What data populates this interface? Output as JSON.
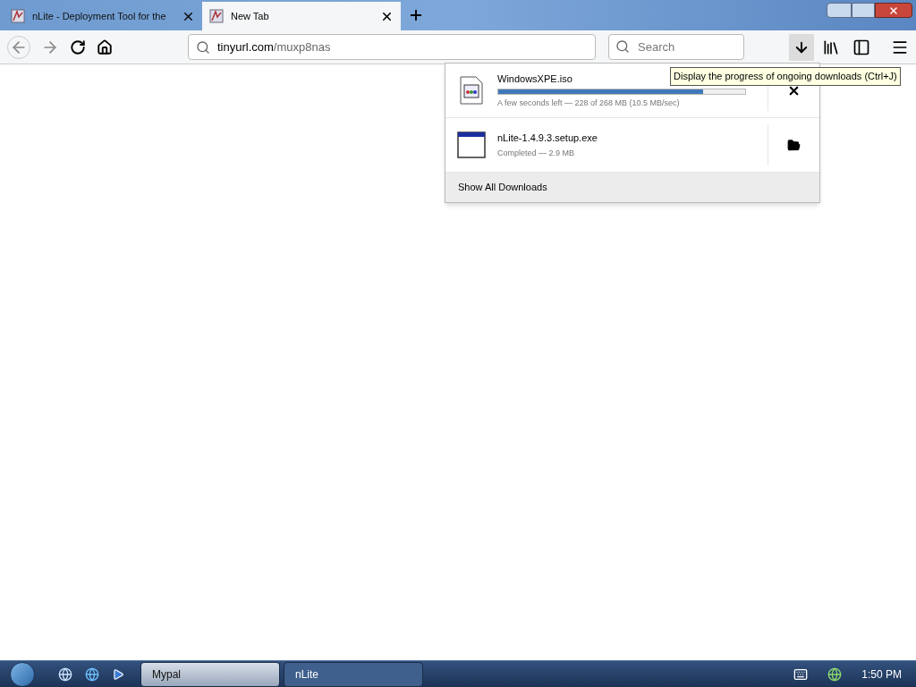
{
  "tabs": [
    {
      "title": "nLite - Deployment Tool for the",
      "selected": false
    },
    {
      "title": "New Tab",
      "selected": true
    }
  ],
  "address": {
    "host": "tinyurl.com",
    "path": "/muxp8nas"
  },
  "search": {
    "placeholder": "Search"
  },
  "toolbar": {
    "downloads_pressed": true
  },
  "downloads": {
    "items": [
      {
        "kind": "in_progress",
        "name": "WindowsXPE.iso",
        "status": "A few seconds left — 228 of 268 MB (10.5 MB/sec)",
        "level": 0.83
      },
      {
        "kind": "completed",
        "name": "nLite-1.4.9.3.setup.exe",
        "status": "Completed — 2.9 MB"
      }
    ],
    "footer": "Show All Downloads"
  },
  "tooltip": "Display the progress of ongoing downloads (Ctrl+J)",
  "taskbar": {
    "buttons": [
      {
        "label": "Mypal",
        "selected": true
      },
      {
        "label": "nLite",
        "selected": false
      }
    ],
    "clock": "1:50 PM"
  }
}
